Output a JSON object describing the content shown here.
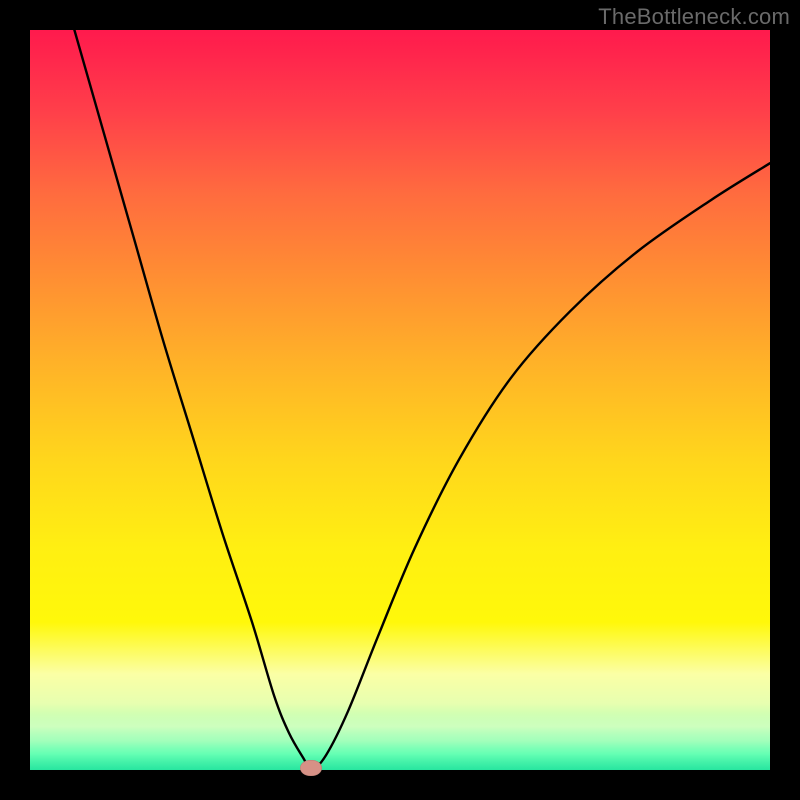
{
  "watermark": "TheBottleneck.com",
  "colors": {
    "frame": "#000000",
    "curve": "#000000",
    "dot": "#d69186",
    "gradient_top": "#ff1a4d",
    "gradient_bottom": "#00e59c"
  },
  "chart_data": {
    "type": "line",
    "title": "",
    "xlabel": "",
    "ylabel": "",
    "xlim": [
      0,
      100
    ],
    "ylim": [
      0,
      100
    ],
    "annotations": {
      "minimum_marker": {
        "x": 38,
        "y": 0,
        "shape": "oval",
        "color": "#d69186"
      }
    },
    "series": [
      {
        "name": "bottleneck_curve",
        "x": [
          6,
          10,
          14,
          18,
          22,
          26,
          30,
          33,
          35,
          37,
          38,
          40,
          43,
          47,
          52,
          58,
          65,
          73,
          82,
          92,
          100
        ],
        "y": [
          100,
          86,
          72,
          58,
          45,
          32,
          20,
          10,
          5,
          1.5,
          0,
          2,
          8,
          18,
          30,
          42,
          53,
          62,
          70,
          77,
          82
        ]
      }
    ]
  }
}
